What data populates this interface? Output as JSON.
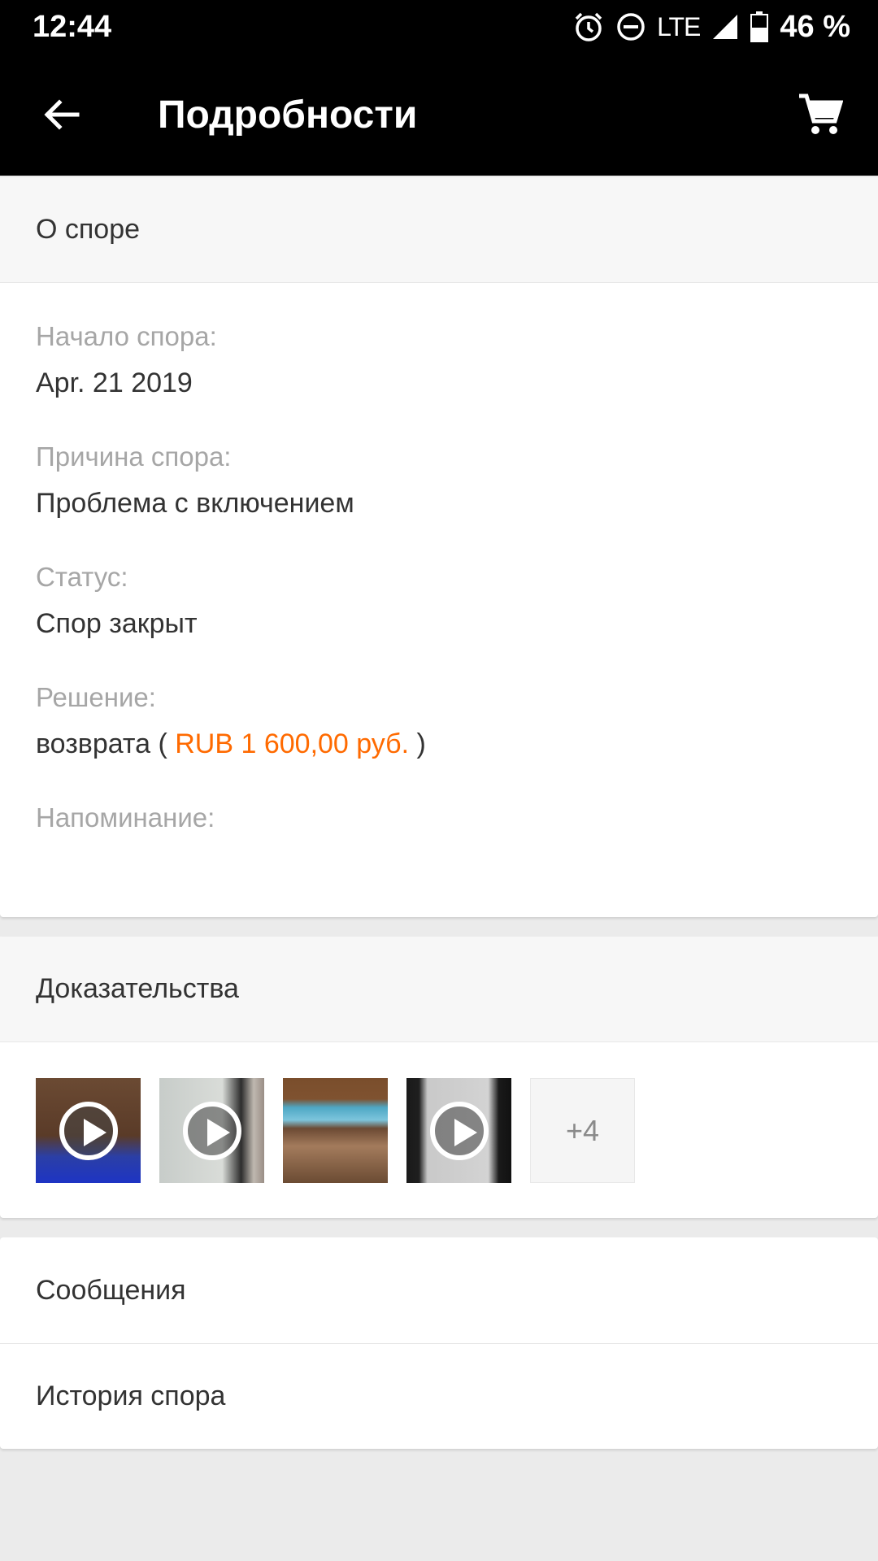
{
  "status_bar": {
    "time": "12:44",
    "network": "LTE",
    "battery": "46 %",
    "icons": [
      "alarm-icon",
      "do-not-disturb-icon",
      "signal-icon",
      "battery-icon"
    ]
  },
  "app_bar": {
    "title": "Подробности",
    "back_icon": "arrow-left-icon",
    "cart_icon": "cart-icon"
  },
  "dispute": {
    "header": "О споре",
    "start_label": "Начало спора:",
    "start_value": "Apr. 21 2019",
    "reason_label": "Причина спора:",
    "reason_value": "Проблема с включением",
    "status_label": "Статус:",
    "status_value": "Спор закрыт",
    "decision_label": "Решение:",
    "decision_prefix": "возврата ( ",
    "decision_amount": "RUB 1 600,00 руб.",
    "decision_suffix": " )",
    "reminder_label": "Напоминание:"
  },
  "evidence": {
    "header": "Доказательства",
    "more_count": "+4"
  },
  "links": {
    "messages": "Сообщения",
    "history": "История спора"
  },
  "colors": {
    "accent": "#ff6a00",
    "app_bar": "#000000",
    "background": "#ebebeb"
  }
}
